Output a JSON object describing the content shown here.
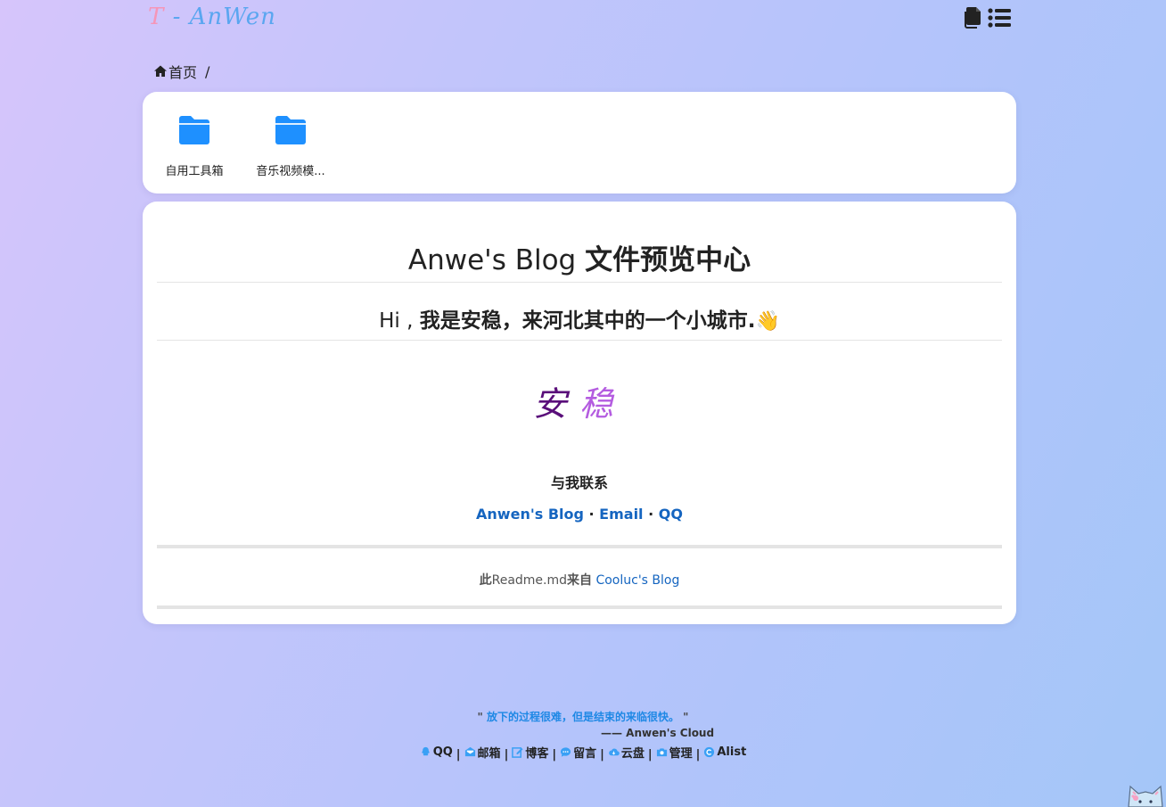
{
  "header": {
    "logo_t": "T",
    "logo_rest": " - AnWen",
    "icons": [
      "copy-icon",
      "list-icon"
    ]
  },
  "breadcrumb": {
    "home_label": "首页",
    "separator": "/"
  },
  "folders": [
    {
      "name": "自用工具箱",
      "icon": "folder-icon"
    },
    {
      "name": "音乐视频模...",
      "icon": "folder-icon"
    }
  ],
  "readme": {
    "title_plain": "Anwe's Blog ",
    "title_bold": "文件预览中心",
    "greeting_plain": "Hi , ",
    "greeting_bold": "我是安稳，来河北其中的一个小城市.",
    "greeting_emoji": "👋",
    "signature_chars": [
      "安",
      "稳"
    ],
    "contact_title": "与我联系",
    "contact_links": [
      {
        "label": "Anwen's Blog"
      },
      {
        "label": "Email"
      },
      {
        "label": "QQ"
      }
    ],
    "link_separator": " · ",
    "credit_bold_1": "此",
    "credit_text": "Readme.md",
    "credit_bold_2": "来自",
    "credit_link": "Cooluc's Blog"
  },
  "footer": {
    "quote_open": "\" ",
    "quote_text": "放下的过程很难，但是结束的来临很快。",
    "quote_close": " \"",
    "quote_author": "—— Anwen's Cloud",
    "links": [
      {
        "label": "QQ",
        "icon": "qq-icon"
      },
      {
        "label": "邮箱",
        "icon": "mail-icon"
      },
      {
        "label": "博客",
        "icon": "edit-icon"
      },
      {
        "label": "留言",
        "icon": "comment-icon"
      },
      {
        "label": "云盘",
        "icon": "cloud-icon"
      },
      {
        "label": "管理",
        "icon": "camera-icon"
      },
      {
        "label": "Alist",
        "icon": "alist-icon"
      }
    ],
    "separator": "|"
  },
  "colors": {
    "accent_blue": "#1565c0",
    "folder_blue": "#1e90ff",
    "logo_pink": "#f596b8",
    "logo_blue": "#5aa6f0"
  }
}
